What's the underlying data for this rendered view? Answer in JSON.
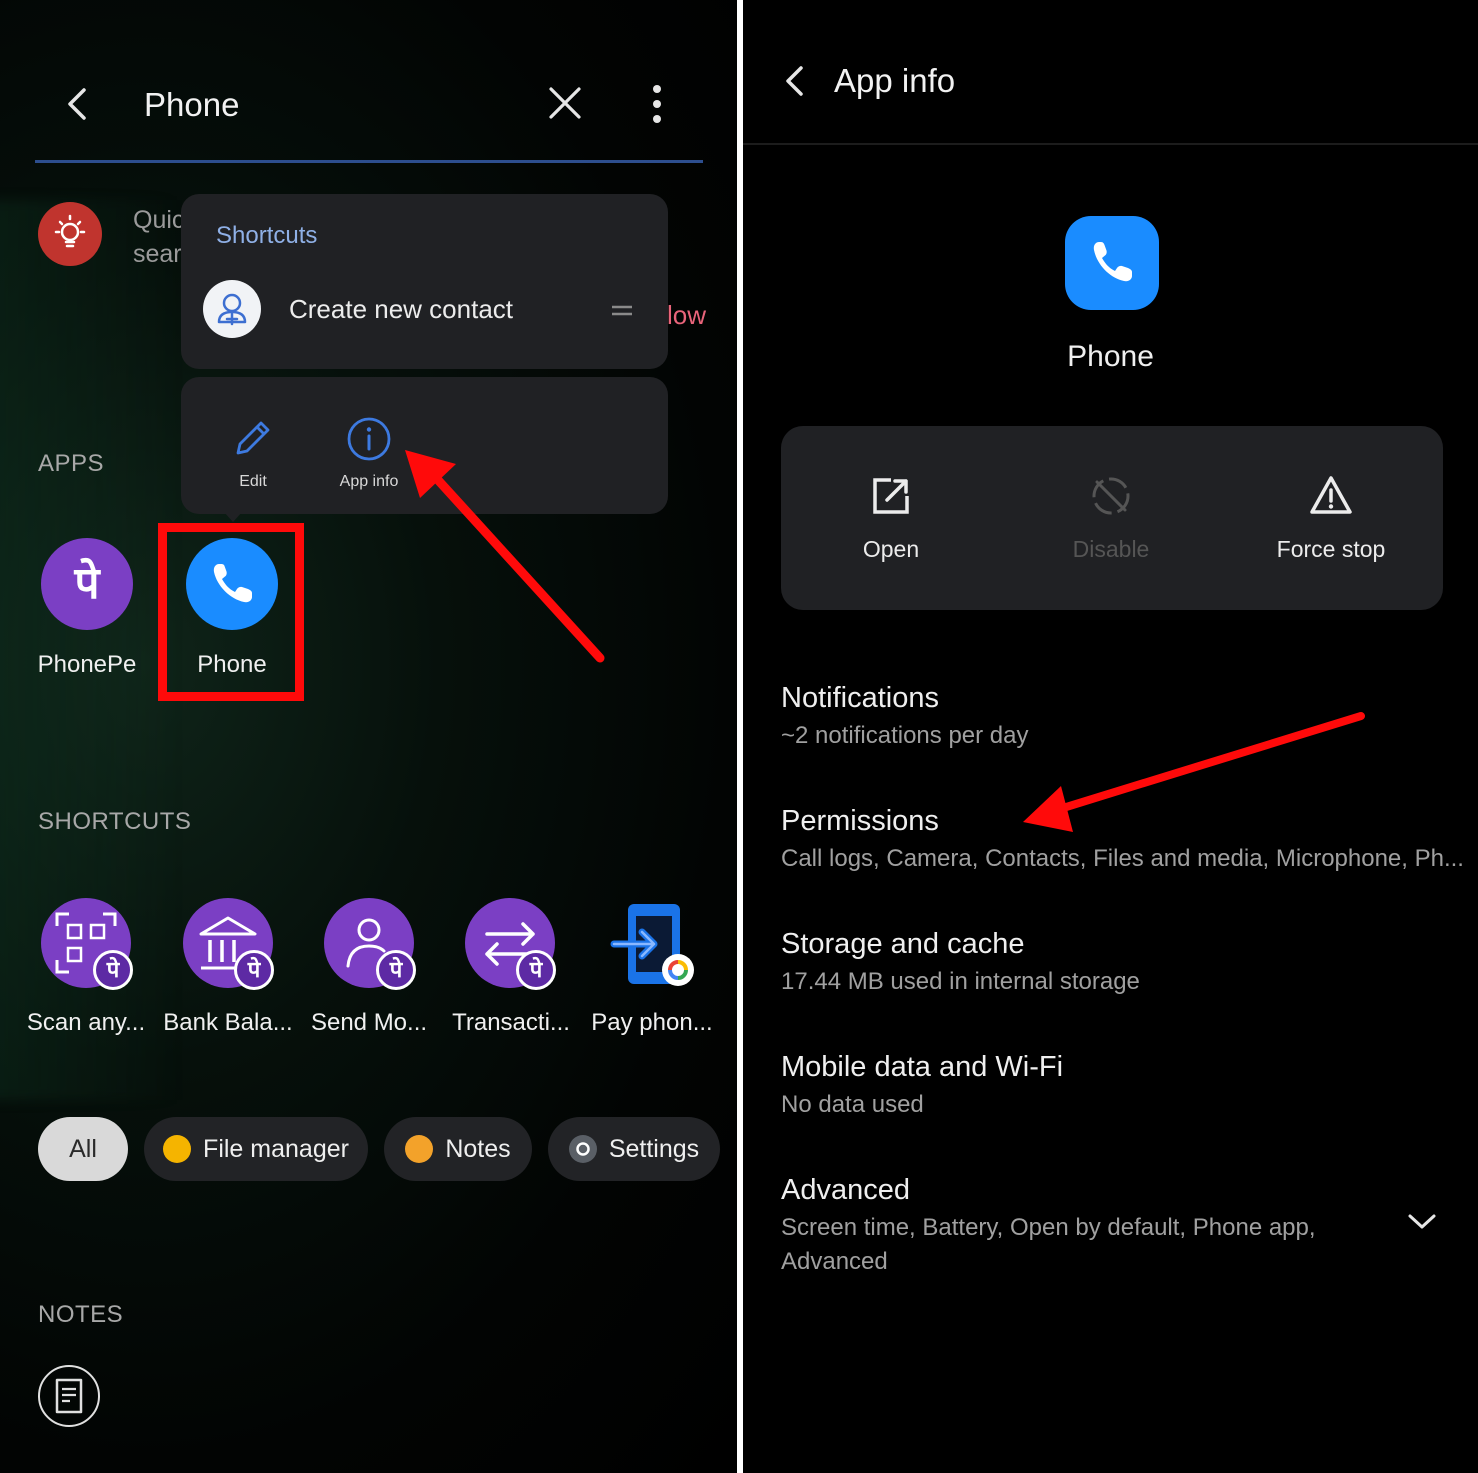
{
  "left": {
    "header": {
      "title": "Phone"
    },
    "quick_hint": {
      "line1": "Quic",
      "line2": "sear"
    },
    "peek_text": "low",
    "popup": {
      "shortcuts_label": "Shortcuts",
      "create_contact": "Create new contact",
      "edit_label": "Edit",
      "app_info_label": "App info"
    },
    "apps_section": "APPS",
    "apps": [
      {
        "label": "PhonePe",
        "glyph": "पे"
      },
      {
        "label": "Phone"
      }
    ],
    "shortcuts_section": "SHORTCUTS",
    "shortcut_badge_glyph": "पे",
    "shortcuts": [
      {
        "label": "Scan any..."
      },
      {
        "label": "Bank Bala..."
      },
      {
        "label": "Send Mo..."
      },
      {
        "label": "Transacti..."
      },
      {
        "label": "Pay phon..."
      }
    ],
    "chips": [
      {
        "label": "All"
      },
      {
        "label": "File manager"
      },
      {
        "label": "Notes"
      },
      {
        "label": "Settings"
      }
    ],
    "notes_section": "NOTES"
  },
  "right": {
    "header": {
      "title": "App info"
    },
    "app_name": "Phone",
    "actions": [
      {
        "label": "Open"
      },
      {
        "label": "Disable"
      },
      {
        "label": "Force stop"
      }
    ],
    "rows": [
      {
        "title": "Notifications",
        "subtitle": "~2 notifications per day"
      },
      {
        "title": "Permissions",
        "subtitle": "Call logs, Camera, Contacts, Files and media, Microphone, Ph..."
      },
      {
        "title": "Storage and cache",
        "subtitle": "17.44 MB used in internal storage"
      },
      {
        "title": "Mobile data and Wi-Fi",
        "subtitle": "No data used"
      },
      {
        "title": "Advanced",
        "subtitle_line1": "Screen time, Battery, Open by default, Phone app,",
        "subtitle_line2": "Advanced"
      }
    ]
  },
  "colors": {
    "annotation_red": "#ff0a0a",
    "phone_blue": "#1a8cff",
    "phonepe_purple": "#7b3fc4",
    "link_blue": "#8fb0e6"
  }
}
